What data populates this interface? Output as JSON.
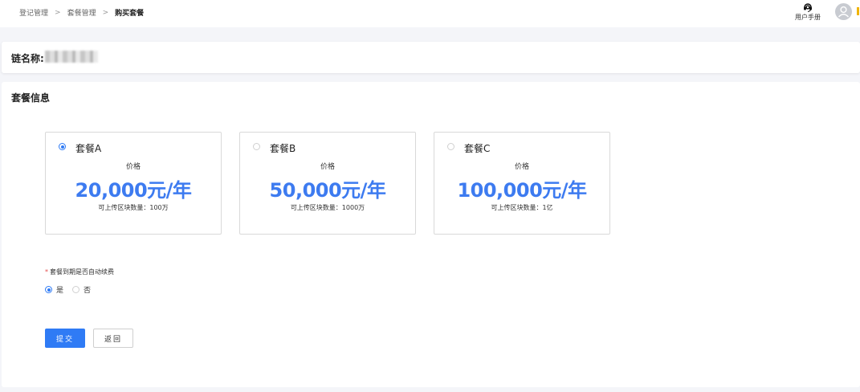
{
  "breadcrumb": {
    "items": [
      "登记管理",
      "套餐管理"
    ],
    "separator": ">",
    "current": "购买套餐"
  },
  "header": {
    "help_label": "用户手册",
    "help_icon": "headset-icon",
    "avatar_icon": "user-avatar-icon"
  },
  "chain": {
    "label": "链名称:"
  },
  "section": {
    "title": "套餐信息"
  },
  "packages": [
    {
      "name": "套餐A",
      "price_label": "价格",
      "price": "20,000元/年",
      "quota": "可上传区块数量：100万",
      "selected": true
    },
    {
      "name": "套餐B",
      "price_label": "价格",
      "price": "50,000元/年",
      "quota": "可上传区块数量：1000万",
      "selected": false
    },
    {
      "name": "套餐C",
      "price_label": "价格",
      "price": "100,000元/年",
      "quota": "可上传区块数量：1亿",
      "selected": false
    }
  ],
  "renew": {
    "required_mark": "*",
    "label": "套餐到期是否自动续费",
    "options": [
      {
        "label": "是",
        "selected": true
      },
      {
        "label": "否",
        "selected": false
      }
    ]
  },
  "actions": {
    "submit_label": "提交",
    "back_label": "返回"
  },
  "colors": {
    "accent": "#2f7bf5",
    "price": "#3d7bf0",
    "required": "#e34d4d"
  }
}
